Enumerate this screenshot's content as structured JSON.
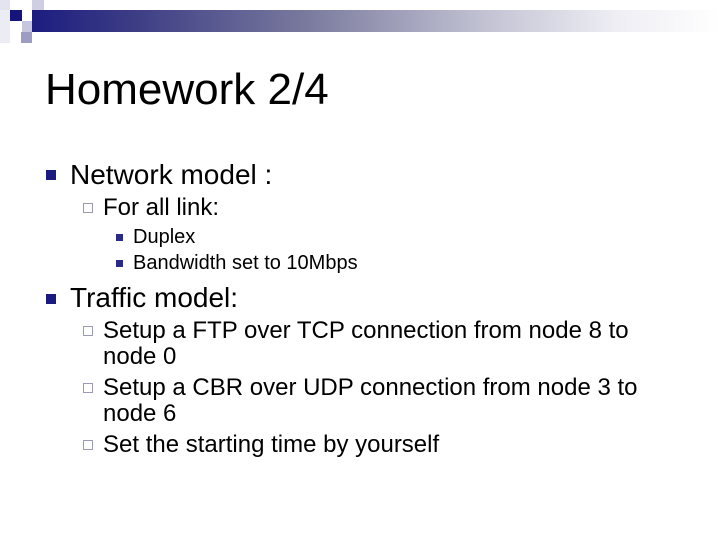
{
  "slide": {
    "title": "Homework 2/4",
    "sections": [
      {
        "label": "Network model :",
        "items": [
          {
            "label": "For all link:",
            "subitems": [
              "Duplex",
              "Bandwidth set to 10Mbps"
            ]
          }
        ]
      },
      {
        "label": "Traffic model:",
        "items": [
          {
            "lines": [
              "Setup a FTP over TCP connection from node 8 to",
              "node 0"
            ]
          },
          {
            "lines": [
              "Setup a CBR over UDP connection from node 3 to",
              "node 6"
            ]
          },
          {
            "lines": [
              "Set the starting time by yourself"
            ]
          }
        ]
      }
    ]
  },
  "colors": {
    "accent_navy": "#1a1a80",
    "sub_bullet": "#9a9ab4"
  }
}
